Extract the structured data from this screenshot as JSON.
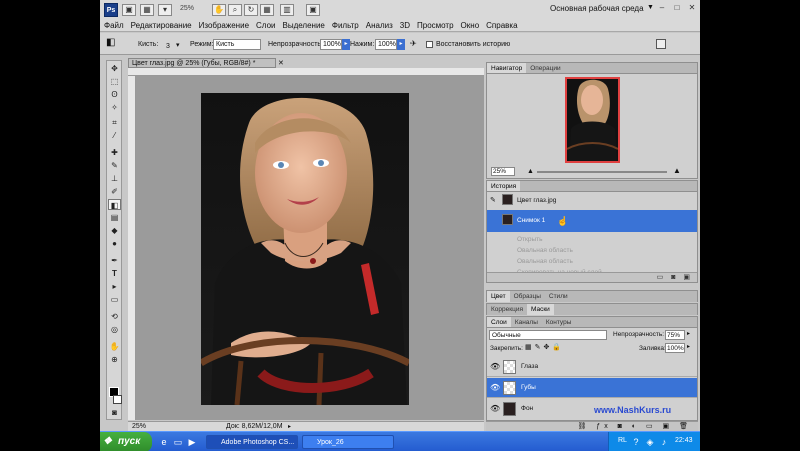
{
  "app": {
    "logo": "Ps",
    "workspace": "Основная рабочая среда",
    "zoom_top": "25%"
  },
  "menu": [
    "Файл",
    "Редактирование",
    "Изображение",
    "Слои",
    "Выделение",
    "Фильтр",
    "Анализ",
    "3D",
    "Просмотр",
    "Окно",
    "Справка"
  ],
  "options": {
    "brush_label": "Кисть:",
    "brush_size": "3",
    "mode_label": "Режим:",
    "mode_value": "Кисть",
    "opacity_label": "Непрозрачность:",
    "opacity_value": "100%",
    "pressure_label": "Нажим:",
    "pressure_value": "100%",
    "restore_history": "Восстановить историю"
  },
  "document": {
    "tab_title": "Цвет глаз.jpg @ 25% (Губы, RGB/8#) *",
    "zoom": "25%",
    "doc_size": "Док: 8,62M/12,0M"
  },
  "navigator": {
    "tabs": [
      "Навигатор",
      "Операции"
    ],
    "zoom": "25%"
  },
  "history": {
    "tab": "История",
    "source": "Цвет глаз.jpg",
    "items": [
      {
        "label": "Снимок 1",
        "state": "selected"
      },
      {
        "label": "Открыть",
        "state": "dim"
      },
      {
        "label": "Овальная область",
        "state": "dim"
      },
      {
        "label": "Овальная область",
        "state": "dim"
      },
      {
        "label": "Скопировать на новый слой",
        "state": "dim"
      }
    ]
  },
  "color_panel": {
    "tabs": [
      "Цвет",
      "Образцы",
      "Стили"
    ]
  },
  "adjust_panel": {
    "tabs": [
      "Коррекция",
      "Маски"
    ]
  },
  "layers": {
    "tabs": [
      "Слои",
      "Каналы",
      "Контуры"
    ],
    "blend_mode": "Обычные",
    "opacity_label": "Непрозрачность:",
    "opacity": "75%",
    "lock_label": "Закрепить:",
    "fill_label": "Заливка:",
    "fill": "100%",
    "items": [
      {
        "name": "Глаза",
        "selected": false
      },
      {
        "name": "Губы",
        "selected": true
      },
      {
        "name": "Фон",
        "selected": false
      }
    ]
  },
  "watermark": "www.NashKurs.ru",
  "taskbar": {
    "start": "пуск",
    "tasks": [
      "Adobe Photoshop CS...",
      "Урок_26"
    ],
    "lang": "RL",
    "clock": "22:43"
  },
  "icons": {
    "eye": "👁",
    "brush": "✎",
    "move": "✥",
    "marquee": "⬚",
    "lasso": "ʘ",
    "crop": "⌗",
    "eyedropper": "⁄",
    "heal": "✚",
    "stamp": "⊥",
    "eraser": "◧",
    "gradient": "▤",
    "blur": "◆",
    "dodge": "●",
    "pen": "✒",
    "type": "T",
    "path": "▸",
    "shape": "▭",
    "hand": "✋",
    "zoom": "⊕"
  }
}
